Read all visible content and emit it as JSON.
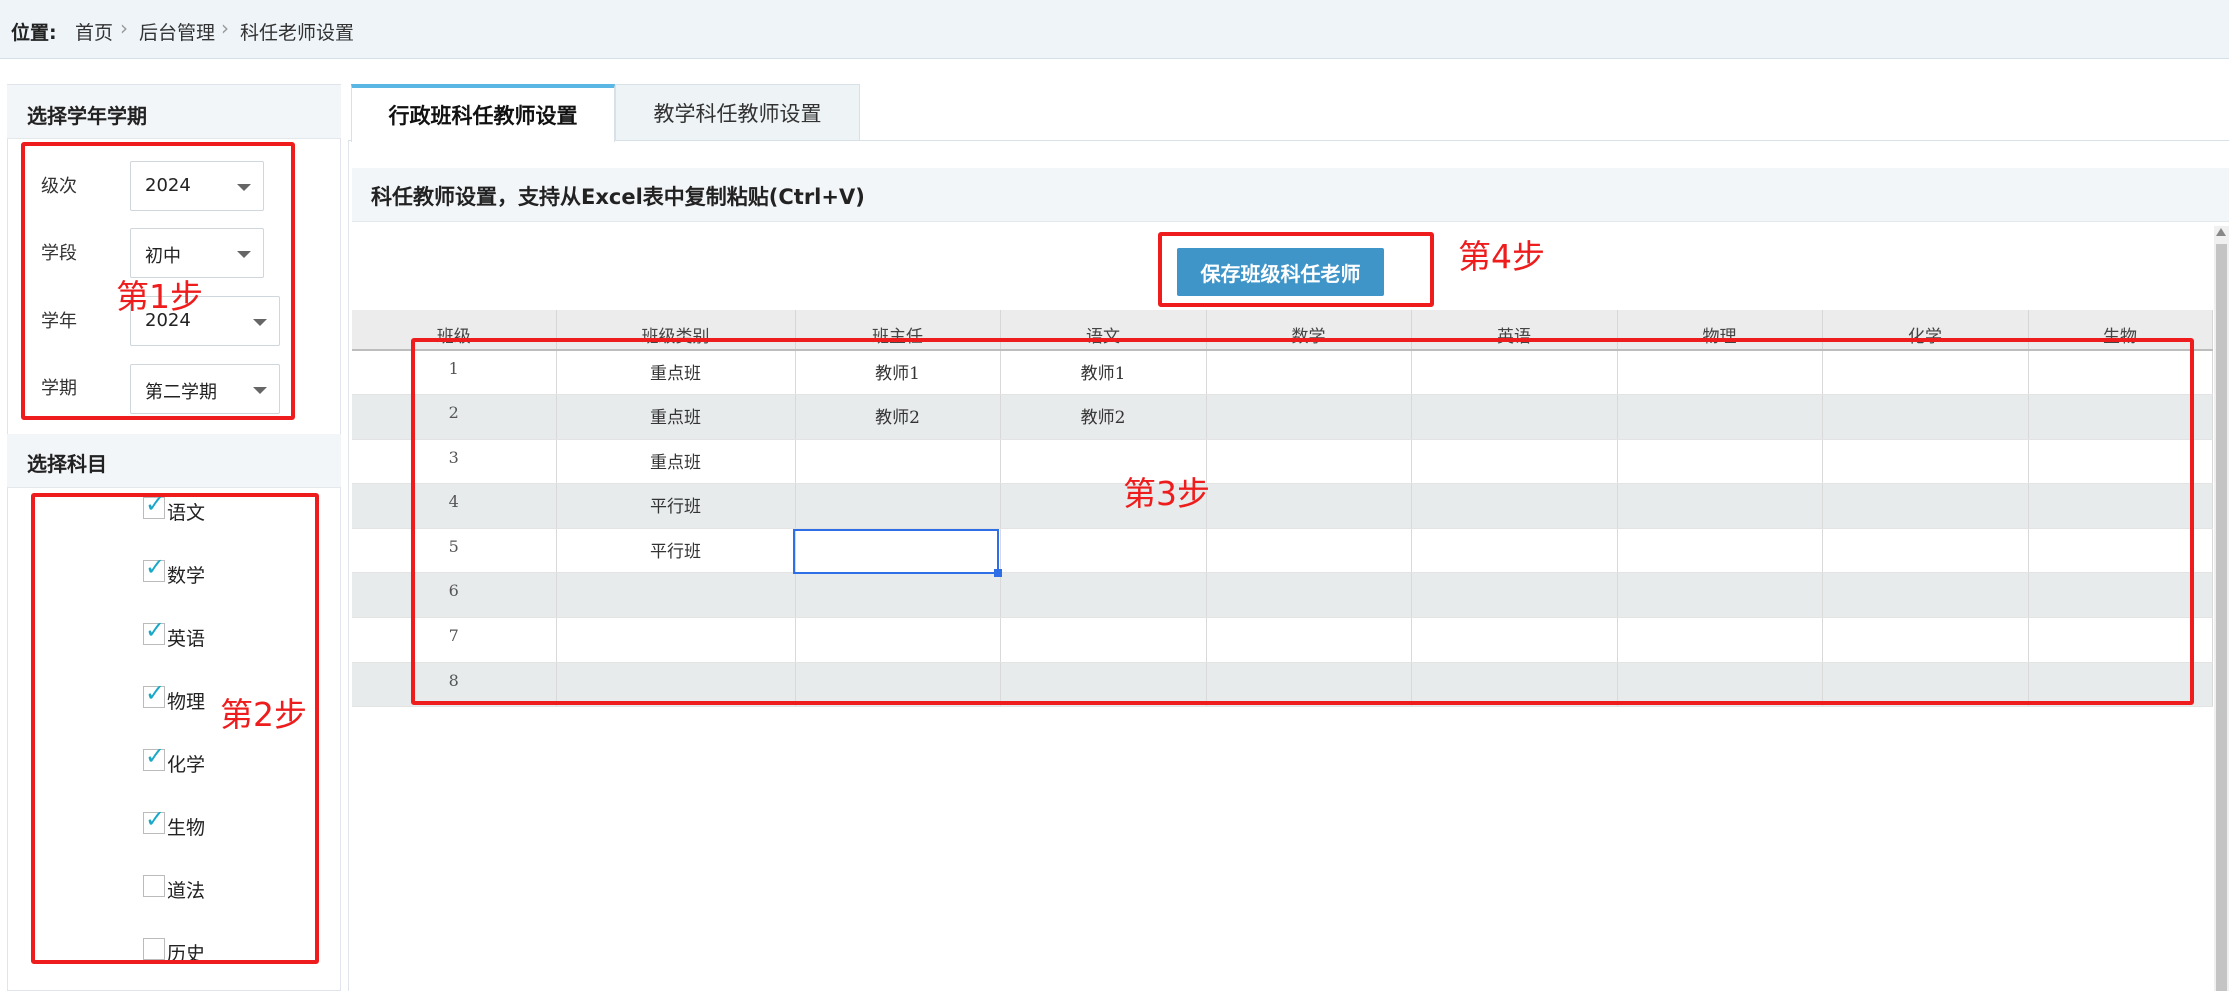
{
  "breadcrumb": {
    "label": "位置:",
    "items": [
      "首页",
      "后台管理",
      "科任老师设置"
    ],
    "separator": "›"
  },
  "term_panel": {
    "title": "选择学年学期",
    "fields": [
      {
        "label": "级次",
        "value": "2024"
      },
      {
        "label": "学段",
        "value": "初中"
      },
      {
        "label": "学年",
        "value": "2024"
      },
      {
        "label": "学期",
        "value": "第二学期"
      }
    ]
  },
  "subject_panel": {
    "title": "选择科目",
    "subjects": [
      {
        "label": "语文",
        "checked": true
      },
      {
        "label": "数学",
        "checked": true
      },
      {
        "label": "英语",
        "checked": true
      },
      {
        "label": "物理",
        "checked": true
      },
      {
        "label": "化学",
        "checked": true
      },
      {
        "label": "生物",
        "checked": true
      },
      {
        "label": "道法",
        "checked": false
      },
      {
        "label": "历史",
        "checked": false
      }
    ]
  },
  "tabs": [
    {
      "label": "行政班科任教师设置",
      "active": true
    },
    {
      "label": "教学科任教师设置",
      "active": false
    }
  ],
  "main": {
    "subtitle": "科任教师设置，支持从Excel表中复制粘贴(Ctrl+V)",
    "save_label": "保存班级科任老师"
  },
  "grid": {
    "columns": [
      "班级",
      "班级类别",
      "班主任",
      "语文",
      "数学",
      "英语",
      "物理",
      "化学",
      "生物"
    ],
    "rows": [
      [
        "1",
        "重点班",
        "教师1",
        "教师1",
        "",
        "",
        "",
        "",
        ""
      ],
      [
        "2",
        "重点班",
        "教师2",
        "教师2",
        "",
        "",
        "",
        "",
        ""
      ],
      [
        "3",
        "重点班",
        "",
        "",
        "",
        "",
        "",
        "",
        ""
      ],
      [
        "4",
        "平行班",
        "",
        "",
        "",
        "",
        "",
        "",
        ""
      ],
      [
        "5",
        "平行班",
        "",
        "",
        "",
        "",
        "",
        "",
        ""
      ],
      [
        "6",
        "",
        "",
        "",
        "",
        "",
        "",
        "",
        ""
      ],
      [
        "7",
        "",
        "",
        "",
        "",
        "",
        "",
        "",
        ""
      ],
      [
        "8",
        "",
        "",
        "",
        "",
        "",
        "",
        "",
        ""
      ]
    ]
  },
  "annotations": {
    "step1": "第1步",
    "step2": "第2步",
    "step3": "第3步",
    "step4": "第4步"
  },
  "colors": {
    "annotation_red": "#ee1c1c",
    "button_blue": "#3f95c8",
    "tab_accent": "#5ab6e2",
    "check_teal": "#1aa8c8"
  }
}
